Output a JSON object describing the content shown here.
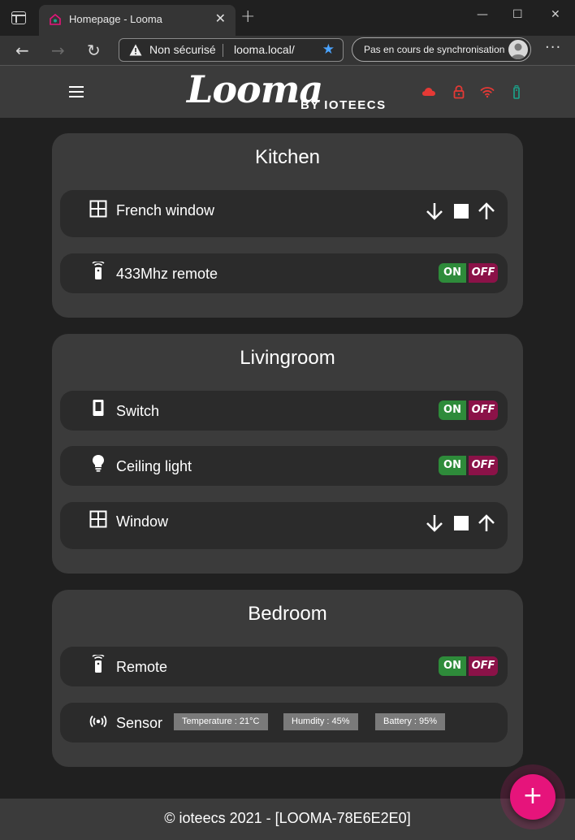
{
  "browser": {
    "tab_title": "Homepage - Looma",
    "tab_close": "✕",
    "new_tab": "+",
    "minimize": "—",
    "maximize": "☐",
    "close": "✕",
    "back": "←",
    "forward": "→",
    "reload": "↻",
    "security_text": "Non sécurisé",
    "url": "looma.local/",
    "favorite": "★",
    "sync_label": "Pas en cours de synchronisation",
    "more": "···"
  },
  "header": {
    "brand": "Looma",
    "brand_sub": "BY IOTEECS",
    "status_colors": {
      "cloud": "#e53935",
      "lock": "#e53935",
      "wifi": "#e53935",
      "remote": "#1aa58c"
    }
  },
  "rooms": [
    {
      "name": "Kitchen",
      "devices": [
        {
          "label": "French window",
          "icon": "window-icon",
          "type": "cover"
        },
        {
          "label": "433Mhz remote",
          "icon": "remote-icon",
          "type": "switch",
          "on": "ON",
          "off": "OFF"
        }
      ]
    },
    {
      "name": "Livingroom",
      "devices": [
        {
          "label": "Switch",
          "icon": "switch-icon",
          "type": "switch",
          "on": "ON",
          "off": "OFF"
        },
        {
          "label": "Ceiling light",
          "icon": "bulb-icon",
          "type": "switch",
          "on": "ON",
          "off": "OFF"
        },
        {
          "label": "Window",
          "icon": "window-icon",
          "type": "cover"
        }
      ]
    },
    {
      "name": "Bedroom",
      "devices": [
        {
          "label": "Remote",
          "icon": "remote-icon",
          "type": "switch",
          "on": "ON",
          "off": "OFF"
        },
        {
          "label": "Sensor",
          "icon": "sensor-icon",
          "type": "sensor",
          "readings": [
            "Temperature : 21°C",
            "Humdity : 45%",
            "Battery : 95%"
          ]
        }
      ]
    }
  ],
  "footer": {
    "text": "© ioteecs 2021 - [LOOMA-78E6E2E0]"
  },
  "fab": {
    "label": "+"
  },
  "colors": {
    "on": "#2e8b3a",
    "off": "#8b1248",
    "fab": "#e6147b"
  }
}
